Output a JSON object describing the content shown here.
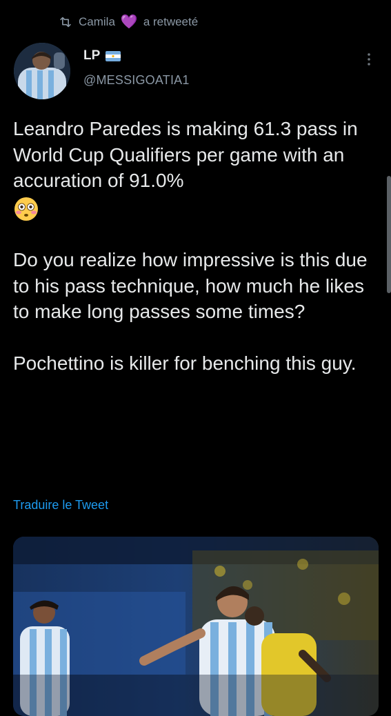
{
  "retweet": {
    "user": "Camila",
    "heart": "💜",
    "action": "a retweeté"
  },
  "author": {
    "name": "LP",
    "flag": "flag-argentina-icon",
    "handle": "@MESSIGOATIA1"
  },
  "tweet": {
    "paragraphs": [
      "Leandro Paredes is making 61.3 pass in World Cup Qualifiers per game with an accuration of 91.0%",
      "Do you realize how impressive is this due to his pass technique, how much he likes to make long passes some times?",
      "Pochettino is killer for benching this guy."
    ],
    "emoji": "flushed-face-emoji"
  },
  "translate_label": "Traduire le Tweet",
  "colors": {
    "background": "#000000",
    "text": "#e7e9ea",
    "muted": "#8b98a5",
    "link": "#1d9bf0",
    "heart": "#a78bdf"
  }
}
